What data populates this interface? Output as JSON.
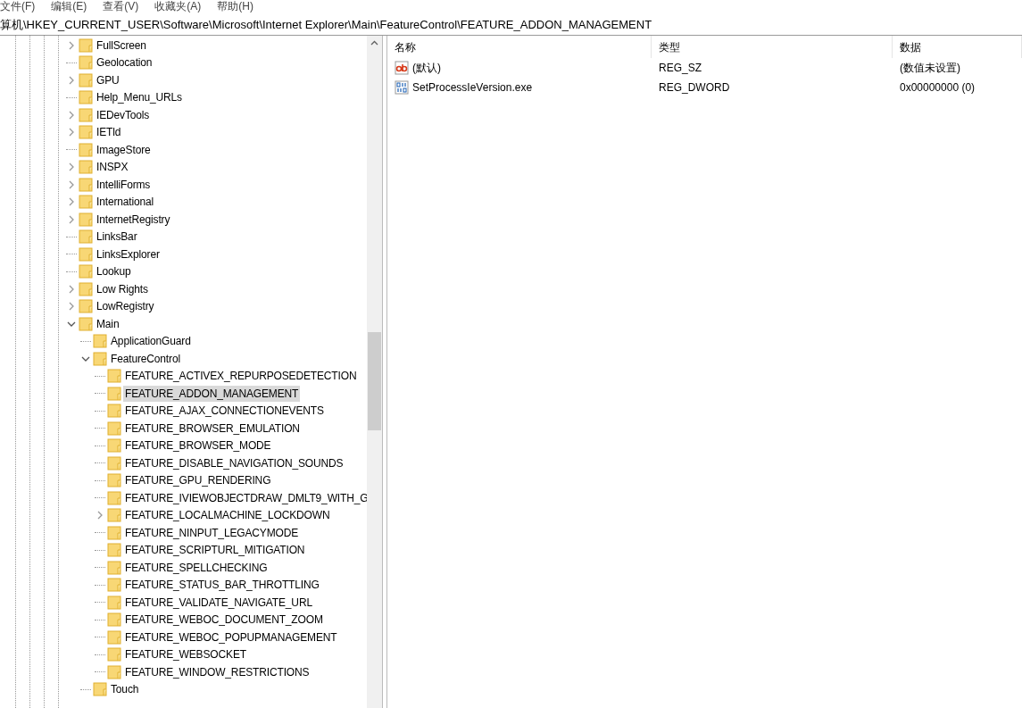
{
  "menu": [
    "文件(F)",
    "编辑(E)",
    "查看(V)",
    "收藏夹(A)",
    "帮助(H)"
  ],
  "address": "算机\\HKEY_CURRENT_USER\\Software\\Microsoft\\Internet Explorer\\Main\\FeatureControl\\FEATURE_ADDON_MANAGEMENT",
  "tree": [
    {
      "label": "FullScreen",
      "kind": "collapsed",
      "selected": false
    },
    {
      "label": "Geolocation",
      "kind": "leaf",
      "selected": false
    },
    {
      "label": "GPU",
      "kind": "collapsed",
      "selected": false
    },
    {
      "label": "Help_Menu_URLs",
      "kind": "leaf",
      "selected": false
    },
    {
      "label": "IEDevTools",
      "kind": "collapsed",
      "selected": false
    },
    {
      "label": "IETld",
      "kind": "collapsed",
      "selected": false
    },
    {
      "label": "ImageStore",
      "kind": "leaf",
      "selected": false
    },
    {
      "label": "INSPX",
      "kind": "collapsed",
      "selected": false
    },
    {
      "label": "IntelliForms",
      "kind": "collapsed",
      "selected": false
    },
    {
      "label": "International",
      "kind": "collapsed",
      "selected": false
    },
    {
      "label": "InternetRegistry",
      "kind": "collapsed",
      "selected": false
    },
    {
      "label": "LinksBar",
      "kind": "leaf",
      "selected": false
    },
    {
      "label": "LinksExplorer",
      "kind": "leaf",
      "selected": false
    },
    {
      "label": "Lookup",
      "kind": "leaf",
      "selected": false
    },
    {
      "label": "Low Rights",
      "kind": "collapsed",
      "selected": false
    },
    {
      "label": "LowRegistry",
      "kind": "collapsed",
      "selected": false
    },
    {
      "label": "Main",
      "kind": "expanded",
      "selected": false,
      "children": [
        {
          "label": "ApplicationGuard",
          "kind": "leaf",
          "selected": false
        },
        {
          "label": "FeatureControl",
          "kind": "expanded",
          "selected": false,
          "children": [
            {
              "label": "FEATURE_ACTIVEX_REPURPOSEDETECTION",
              "kind": "leaf",
              "selected": false
            },
            {
              "label": "FEATURE_ADDON_MANAGEMENT",
              "kind": "leaf",
              "selected": true
            },
            {
              "label": "FEATURE_AJAX_CONNECTIONEVENTS",
              "kind": "leaf",
              "selected": false
            },
            {
              "label": "FEATURE_BROWSER_EMULATION",
              "kind": "leaf",
              "selected": false
            },
            {
              "label": "FEATURE_BROWSER_MODE",
              "kind": "leaf",
              "selected": false
            },
            {
              "label": "FEATURE_DISABLE_NAVIGATION_SOUNDS",
              "kind": "leaf",
              "selected": false
            },
            {
              "label": "FEATURE_GPU_RENDERING",
              "kind": "leaf",
              "selected": false
            },
            {
              "label": "FEATURE_IVIEWOBJECTDRAW_DMLT9_WITH_G",
              "kind": "leaf",
              "selected": false
            },
            {
              "label": "FEATURE_LOCALMACHINE_LOCKDOWN",
              "kind": "collapsed",
              "selected": false
            },
            {
              "label": "FEATURE_NINPUT_LEGACYMODE",
              "kind": "leaf",
              "selected": false
            },
            {
              "label": "FEATURE_SCRIPTURL_MITIGATION",
              "kind": "leaf",
              "selected": false
            },
            {
              "label": "FEATURE_SPELLCHECKING",
              "kind": "leaf",
              "selected": false
            },
            {
              "label": "FEATURE_STATUS_BAR_THROTTLING",
              "kind": "leaf",
              "selected": false
            },
            {
              "label": "FEATURE_VALIDATE_NAVIGATE_URL",
              "kind": "leaf",
              "selected": false
            },
            {
              "label": "FEATURE_WEBOC_DOCUMENT_ZOOM",
              "kind": "leaf",
              "selected": false
            },
            {
              "label": "FEATURE_WEBOC_POPUPMANAGEMENT",
              "kind": "leaf",
              "selected": false
            },
            {
              "label": "FEATURE_WEBSOCKET",
              "kind": "leaf",
              "selected": false
            },
            {
              "label": "FEATURE_WINDOW_RESTRICTIONS",
              "kind": "leaf",
              "selected": false
            }
          ]
        },
        {
          "label": "Touch",
          "kind": "leaf",
          "selected": false
        }
      ]
    }
  ],
  "values": {
    "columns": [
      "名称",
      "类型",
      "数据"
    ],
    "rows": [
      {
        "kind": "string",
        "name": "(默认)",
        "type": "REG_SZ",
        "data": "(数值未设置)"
      },
      {
        "kind": "binary",
        "name": "SetProcessIeVersion.exe",
        "type": "REG_DWORD",
        "data": "0x00000000 (0)"
      }
    ]
  }
}
